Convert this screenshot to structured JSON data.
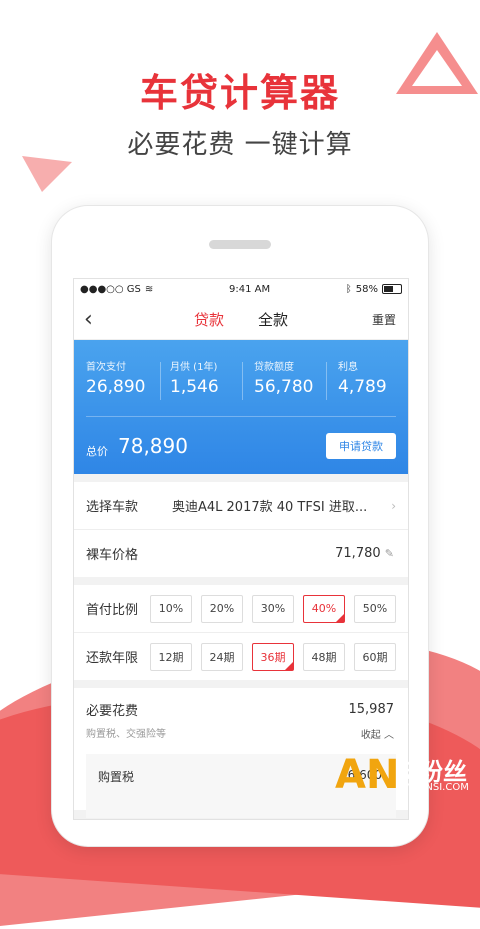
{
  "promo": {
    "headline": "车贷计算器",
    "subline": "必要花费 一键计算",
    "accent": "#e8333a"
  },
  "statusbar": {
    "carrier": "●●●○○ GS",
    "time": "9:41 AM",
    "battery": "58%"
  },
  "navbar": {
    "back_icon": "chevron-left-icon",
    "tab_loan": "贷款",
    "tab_full": "全款",
    "reset": "重置"
  },
  "summary": {
    "stats": [
      {
        "label": "首次支付",
        "value": "26,890"
      },
      {
        "label": "月供 (1年)",
        "value": "1,546"
      },
      {
        "label": "贷款额度",
        "value": "56,780"
      },
      {
        "label": "利息",
        "value": "4,789"
      }
    ],
    "total_label": "总价",
    "total_value": "78,890",
    "apply_button": "申请贷款"
  },
  "car": {
    "model_label": "选择车款",
    "model_value": "奥迪A4L 2017款 40 TFSI 进取...",
    "price_label": "裸车价格",
    "price_value": "71,780"
  },
  "down_payment": {
    "label": "首付比例",
    "options": [
      "10%",
      "20%",
      "30%",
      "40%",
      "50%"
    ],
    "selected": "40%"
  },
  "term": {
    "label": "还款年限",
    "options": [
      "12期",
      "24期",
      "36期",
      "48期",
      "60期"
    ],
    "selected": "36期"
  },
  "expenses": {
    "title": "必要花费",
    "subtitle": "购置税、交强险等",
    "total": "15,987",
    "collapse": "收起",
    "item_label": "购置税",
    "item_value": "6,600"
  },
  "watermark": {
    "logo": "AN",
    "cn": "安粉丝",
    "url": "ANFENSI.COM"
  }
}
